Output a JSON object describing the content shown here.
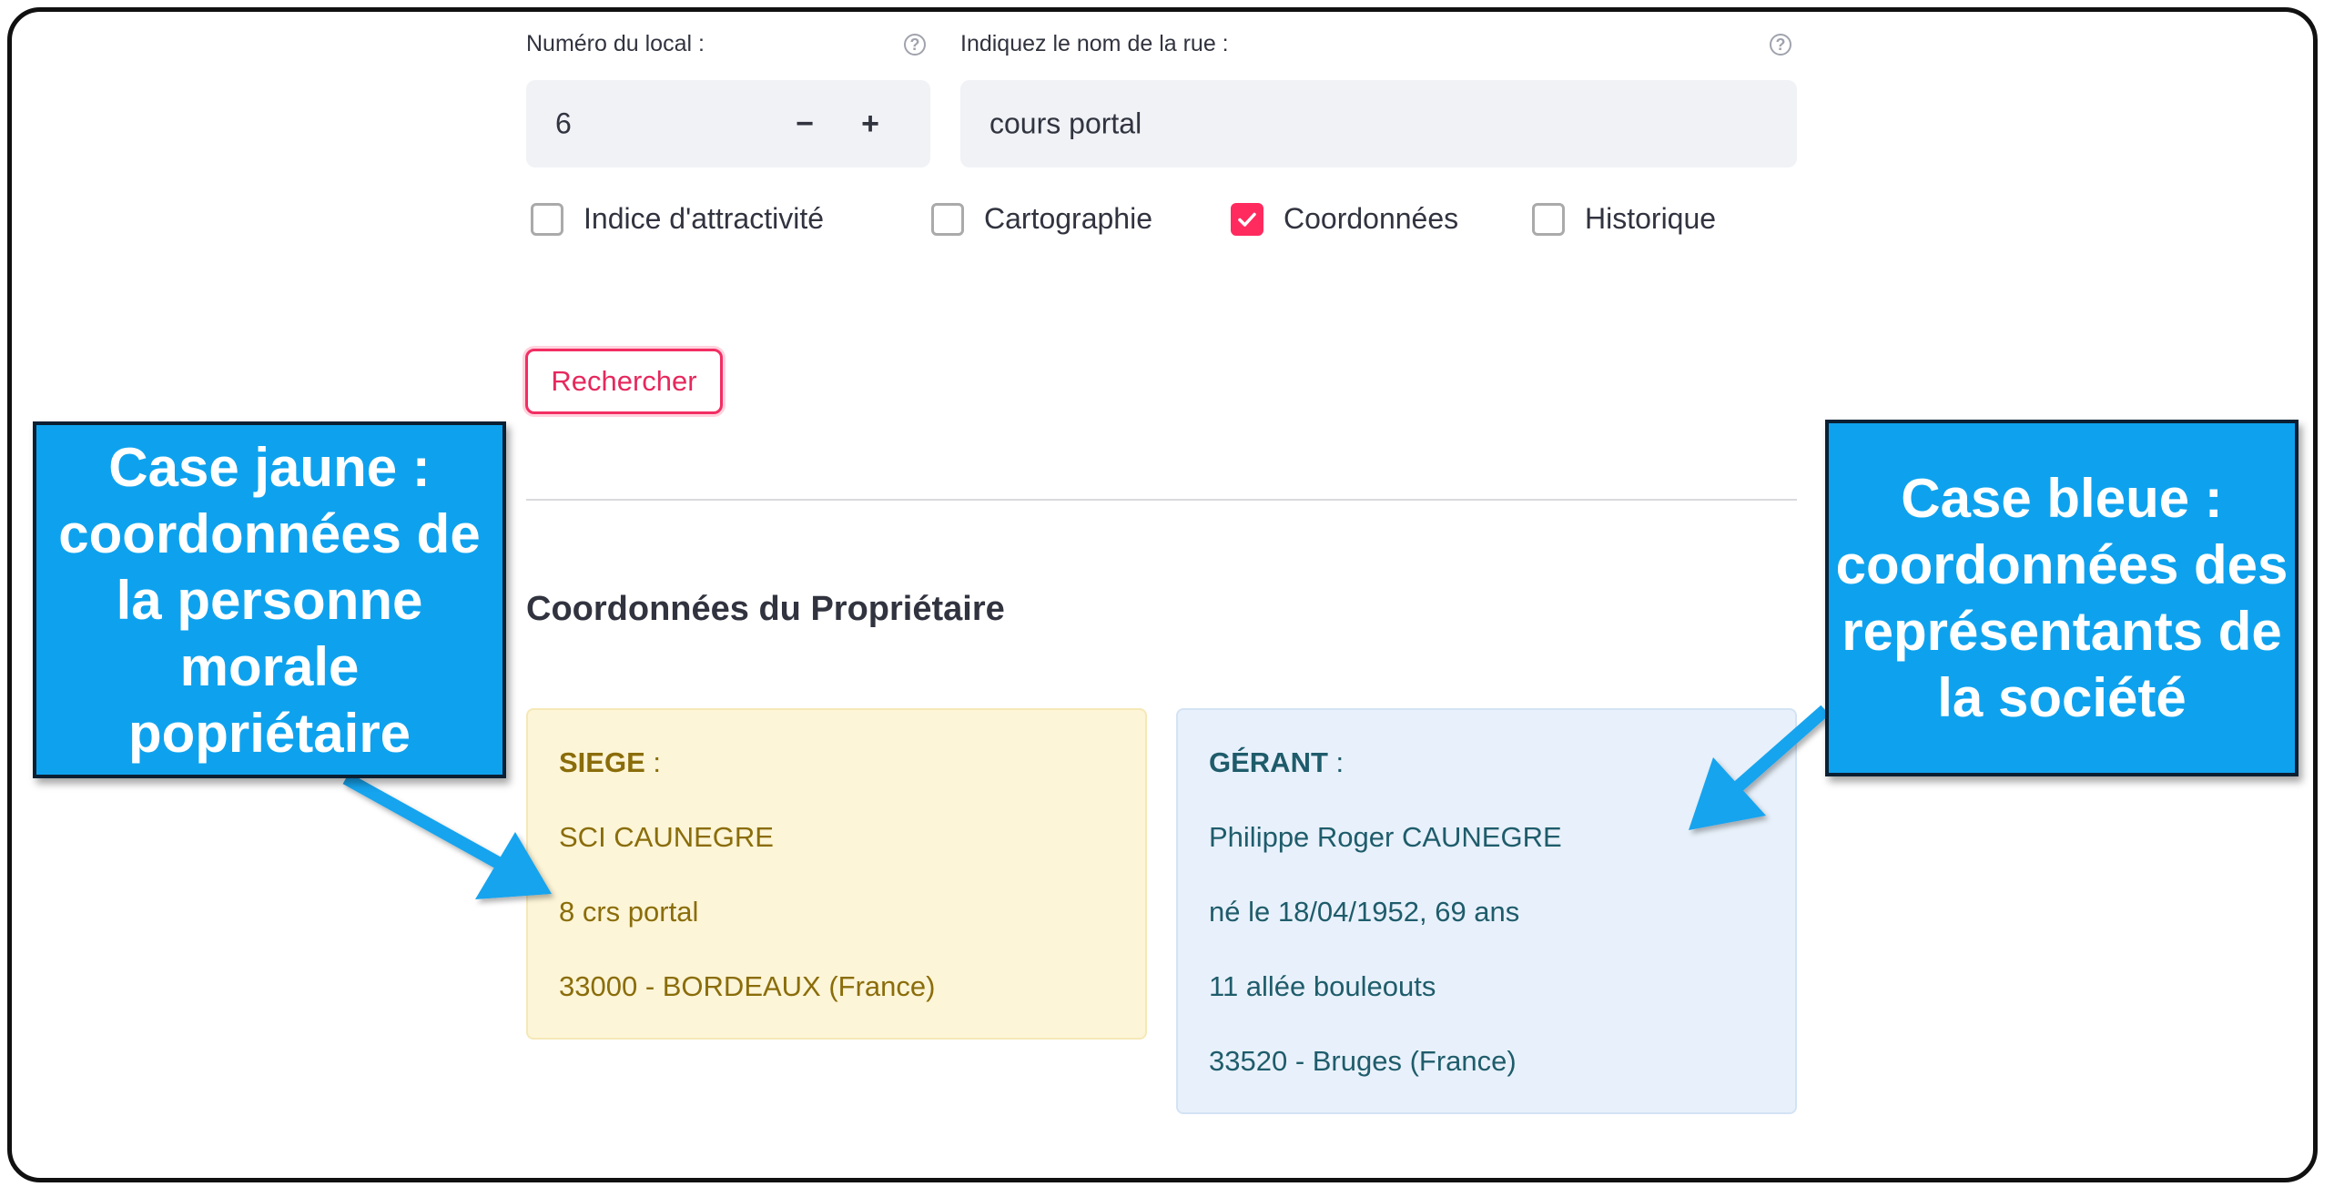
{
  "form": {
    "local_number_label": "Numéro du local :",
    "local_number_value": "6",
    "minus_label": "−",
    "plus_label": "+",
    "street_label": "Indiquez le nom de la rue :",
    "street_value": "cours portal",
    "help_glyph": "?"
  },
  "options": [
    {
      "label": "Indice d'attractivité",
      "checked": false
    },
    {
      "label": "Cartographie",
      "checked": false
    },
    {
      "label": "Coordonnées",
      "checked": true
    },
    {
      "label": "Historique",
      "checked": false
    }
  ],
  "search_button": "Rechercher",
  "section_title": "Coordonnées du Propriétaire",
  "siege_card": {
    "heading": "SIEGE",
    "heading_suffix": " :",
    "lines": [
      "SCI CAUNEGRE",
      "8 crs portal",
      "33000 - BORDEAUX (France)"
    ]
  },
  "gerant_card": {
    "heading": "GÉRANT",
    "heading_suffix": " :",
    "lines": [
      "Philippe Roger CAUNEGRE",
      "né le 18/04/1952, 69 ans",
      "11 allée bouleouts",
      "33520 - Bruges (France)"
    ]
  },
  "callouts": {
    "left": "Case jaune : coordonnées de la personne morale popriétaire",
    "right": "Case bleue : coordonnées des représentants de la société"
  },
  "colors": {
    "accent": "#ff2b5e",
    "callout_blue": "#0ea2ee",
    "yellow_card": "#fdf5d7",
    "blue_card": "#e8f1fb"
  }
}
